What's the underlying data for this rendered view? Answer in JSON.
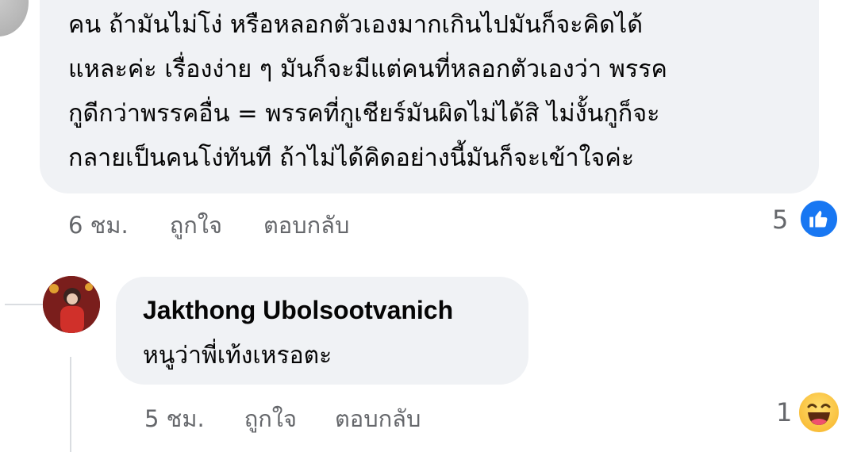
{
  "comment_1": {
    "text_lines": [
      "คน ถ้ามันไม่โง่ หรือหลอกตัวเองมากเกินไปมันก็จะคิดได้",
      "แหละค่ะ เรื่องง่าย ๆ มันก็จะมีแต่คนที่หลอกตัวเองว่า พรรค",
      "กูดีกว่าพรรคอื่น = พรรคที่กูเชียร์มันผิดไม่ได้สิ ไม่งั้นกูก็จะ",
      "กลายเป็นคนโง่ทันที ถ้าไม่ได้คิดอย่างนี้มันก็จะเข้าใจค่ะ"
    ],
    "time": "6 ชม.",
    "like_label": "ถูกใจ",
    "reply_label": "ตอบกลับ",
    "reaction_count": "5",
    "reaction_icon": "like-icon",
    "reaction_color": "#1877f2"
  },
  "comment_2": {
    "author": "Jakthong Ubolsootvanich",
    "text": "หนูว่าพี่เท้งเหรอตะ",
    "time": "5 ชม.",
    "like_label": "ถูกใจ",
    "reply_label": "ตอบกลับ",
    "reaction_count": "1",
    "reaction_icon": "haha-icon"
  },
  "colors": {
    "bubble_bg": "#f0f2f5",
    "meta_text": "#65676b",
    "thread_line": "#dadde1"
  }
}
